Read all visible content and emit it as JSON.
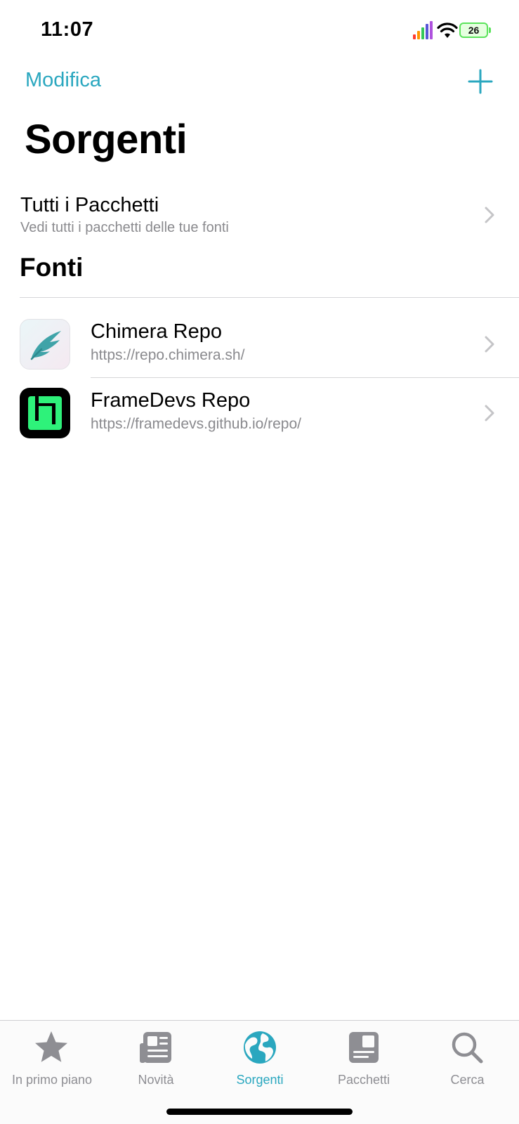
{
  "status": {
    "time": "11:07",
    "battery": "26"
  },
  "nav": {
    "edit_label": "Modifica",
    "add_icon": "plus-icon"
  },
  "title": "Sorgenti",
  "all_packages": {
    "title": "Tutti i Pacchetti",
    "subtitle": "Vedi tutti i pacchetti delle tue fonti"
  },
  "section": {
    "title": "Fonti"
  },
  "repos": [
    {
      "name": "Chimera Repo",
      "url": "https://repo.chimera.sh/",
      "icon": "chimera-feather-icon"
    },
    {
      "name": "FrameDevs Repo",
      "url": "https://framedevs.github.io/repo/",
      "icon": "framedevs-box-icon"
    }
  ],
  "tabs": [
    {
      "label": "In primo piano",
      "icon": "star-icon",
      "active": false
    },
    {
      "label": "Novità",
      "icon": "newspaper-icon",
      "active": false
    },
    {
      "label": "Sorgenti",
      "icon": "globe-icon",
      "active": true
    },
    {
      "label": "Pacchetti",
      "icon": "package-icon",
      "active": false
    },
    {
      "label": "Cerca",
      "icon": "search-icon",
      "active": false
    }
  ],
  "colors": {
    "accent": "#2aa7bf",
    "secondary_text": "#8a8a8e",
    "framedevs_green": "#2ef27a"
  }
}
